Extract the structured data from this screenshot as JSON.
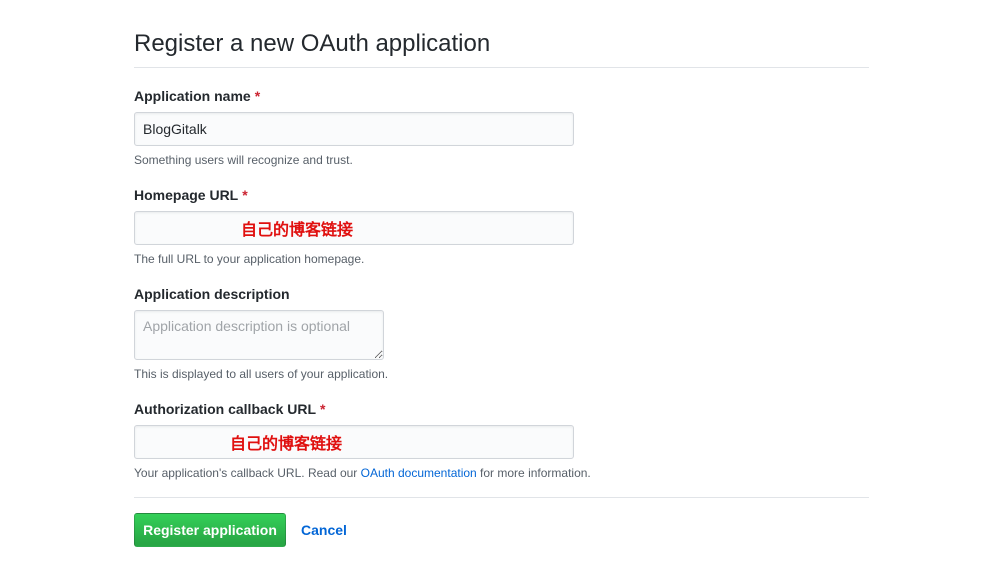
{
  "page": {
    "title": "Register a new OAuth application"
  },
  "form": {
    "app_name": {
      "label": "Application name",
      "required_mark": "*",
      "value": "BlogGitalk",
      "note": "Something users will recognize and trust."
    },
    "homepage_url": {
      "label": "Homepage URL",
      "required_mark": "*",
      "value": "",
      "annotation": "自己的博客链接",
      "note": "The full URL to your application homepage."
    },
    "description": {
      "label": "Application description",
      "placeholder": "Application description is optional",
      "note": "This is displayed to all users of your application."
    },
    "callback_url": {
      "label": "Authorization callback URL",
      "required_mark": "*",
      "value": "",
      "annotation": "自己的博客链接",
      "note_prefix": "Your application's callback URL. Read our ",
      "note_link": "OAuth documentation",
      "note_suffix": " for more information."
    }
  },
  "actions": {
    "register_label": "Register application",
    "cancel_label": "Cancel"
  },
  "colors": {
    "primary_button": "#28a745",
    "link": "#0366d6",
    "required": "#cb2431",
    "annotation": "#e0100f"
  }
}
